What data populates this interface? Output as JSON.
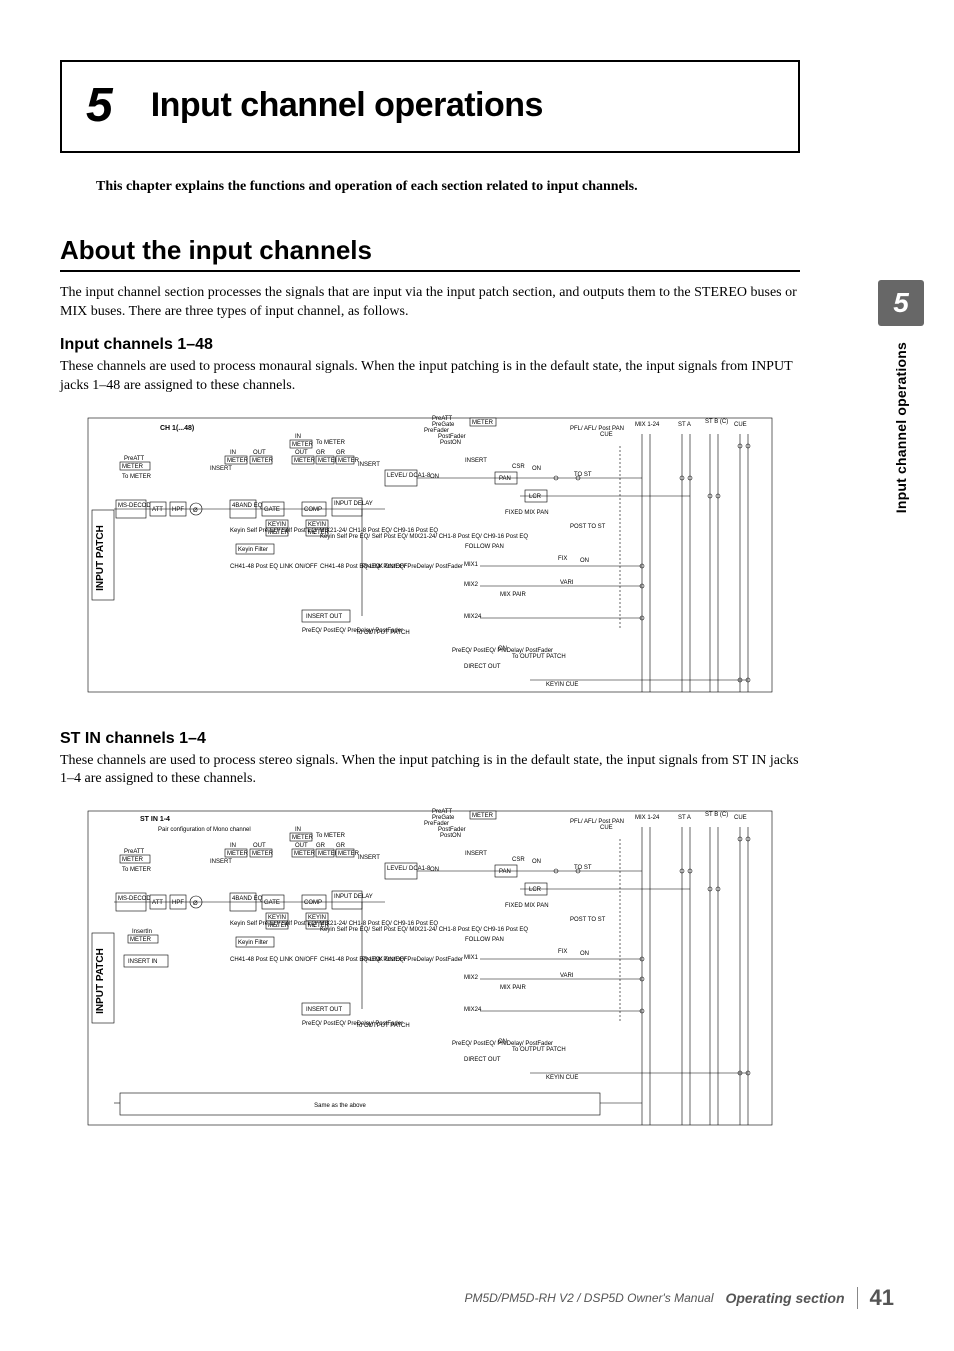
{
  "sideTab": {
    "number": "5",
    "label": "Input channel operations"
  },
  "chapter": {
    "number": "5",
    "title": "Input channel operations"
  },
  "intro": "This chapter explains the functions and operation of each section related to input channels.",
  "section1": {
    "heading": "About the input channels",
    "body": "The input channel section processes the signals that are input via the input patch section, and outputs them to the STEREO buses or MIX buses. There are three types of input channel, as follows."
  },
  "sub1": {
    "heading": "Input channels 1–48",
    "body": "These channels are used to process monaural signals. When the input patching is in the default state, the input signals from INPUT jacks 1–48 are assigned to these channels."
  },
  "sub2": {
    "heading": "ST IN channels 1–4",
    "body": "These channels are used to process stereo signals. When the input patching is in the default state, the input signals from ST IN jacks 1–4 are assigned to these channels."
  },
  "diagram1": {
    "vertLabel": "INPUT PATCH",
    "ch": "CH 1(...48)",
    "toMeterArrow": "To METER",
    "toMeterSmall": "To METER",
    "preAtt": "PreATT",
    "meter": "METER",
    "in": "IN",
    "out": "OUT",
    "gr": "GR",
    "insert": "INSERT",
    "ms": "MS-DECODE",
    "att": "ATT",
    "hpf": "HPF",
    "eq": "4BAND EQ",
    "gate": "GATE",
    "comp": "COMP",
    "inputDelay": "INPUT DELAY",
    "keyin": "KEYIN",
    "keyinFilter": "Keyin Filter",
    "keyinNotes": "Keyin\nSelf Pre EQ/\nSelf Post EQ/\nMIX21-24/\nCH1-8 Post EQ/\nCH9-16 Post EQ",
    "linkNotes": "CH41-48 Post EQ\nLINK ON/OFF",
    "insertOut": "INSERT OUT",
    "preEqNotes": "PreEQ/\nPostEQ/\nPreDelay/\nPostFader",
    "toOutputPatch": "To OUTPUT PATCH",
    "preFader": "PreFader",
    "preGate": "PreGate",
    "postFader": "PostFader",
    "postOn": "PostON",
    "level": "LEVEL/\nDCA1-8",
    "on": "ON",
    "insertTop": "INSERT",
    "pan": "PAN",
    "csr": "CSR",
    "lcr": "LCR",
    "fixedMixPan": "FIXED MIX PAN",
    "followPan": "FOLLOW PAN",
    "mix1": "MIX1",
    "mix2": "MIX2",
    "mix24": "MIX24",
    "mixPair": "MIX PAIR",
    "directOut": "DIRECT OUT",
    "keyinCue": "KEYIN CUE",
    "pfl": "PFL/\nAFL/\nPost PAN",
    "cue": "CUE",
    "toSt": "TO ST",
    "postToSt": "POST TO ST",
    "fix": "FIX",
    "vari": "VARI",
    "mix124": "MIX 1-24",
    "sta": "ST A",
    "stb": "ST B\n(C)",
    "cueHead": "CUE"
  },
  "diagram2": {
    "vertLabel": "INPUT PATCH",
    "stIn": "ST IN 1-4",
    "pairConfig": "Pair configuration of Mono channel",
    "insertIn": "INSERT IN",
    "insertInMeter": "InsertIn",
    "sameAs": "Same as the above"
  },
  "footer": {
    "left": "PM5D/PM5D-RH V2 / DSP5D Owner's Manual",
    "mid": "Operating section",
    "page": "41"
  }
}
